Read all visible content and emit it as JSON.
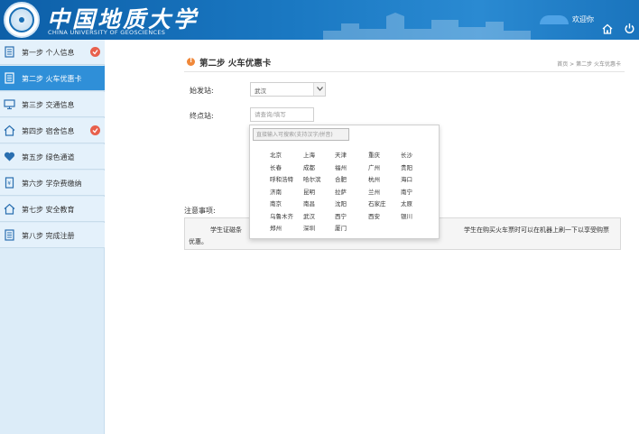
{
  "header": {
    "logo_cn": "中国地质大学",
    "logo_en": "CHINA UNIVERSITY OF GEOSCIENCES",
    "welcome": "欢迎你",
    "colors": {
      "header_blue": "#1a78c2",
      "active_blue": "#2f8fd8",
      "check_red": "#e8604c"
    }
  },
  "sidebar": {
    "items": [
      {
        "label": "第一步 个人信息",
        "icon": "document-icon",
        "done": true
      },
      {
        "label": "第二步 火车优惠卡",
        "icon": "document-icon",
        "active": true
      },
      {
        "label": "第三步 交通信息",
        "icon": "monitor-icon"
      },
      {
        "label": "第四步 宿舍信息",
        "icon": "home-icon",
        "done": true
      },
      {
        "label": "第五步 绿色通道",
        "icon": "heart-icon"
      },
      {
        "label": "第六步 学杂费缴纳",
        "icon": "receipt-icon"
      },
      {
        "label": "第七步 安全教育",
        "icon": "home-icon"
      },
      {
        "label": "第八步 完成注册",
        "icon": "document-icon"
      }
    ]
  },
  "main": {
    "title": "第二步 火车优惠卡",
    "breadcrumb": "首页 > 第二步 火车优惠卡",
    "start_label": "始发站:",
    "start_value": "武汉",
    "end_label": "终点站:",
    "end_placeholder": "请查询/填写",
    "notice_label": "注意事项:",
    "notice_line1a": "学生证磁条",
    "notice_line1b": "学生在购买火车票时可以在机器上刷一下以享受购票",
    "notice_line2": "优惠。"
  },
  "popup": {
    "search_placeholder": "直接输入可搜索(支持汉字/拼音)",
    "cities": [
      [
        "北京",
        "上海",
        "天津",
        "重庆",
        "长沙"
      ],
      [
        "长春",
        "成都",
        "福州",
        "广州",
        "贵阳"
      ],
      [
        "呼和浩特",
        "哈尔滨",
        "合肥",
        "杭州",
        "海口"
      ],
      [
        "济南",
        "昆明",
        "拉萨",
        "兰州",
        "南宁"
      ],
      [
        "南京",
        "南昌",
        "沈阳",
        "石家庄",
        "太原"
      ],
      [
        "乌鲁木齐",
        "武汉",
        "西宁",
        "西安",
        "银川"
      ],
      [
        "郑州",
        "深圳",
        "厦门"
      ]
    ]
  }
}
